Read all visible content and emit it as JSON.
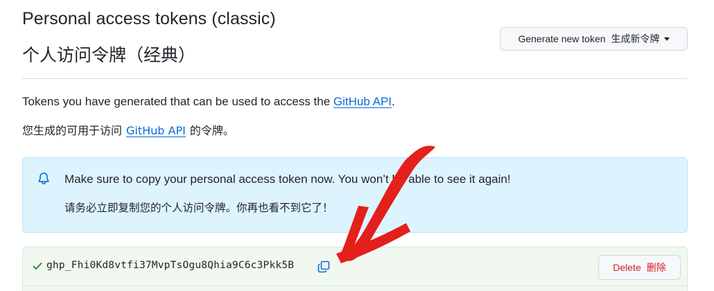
{
  "header": {
    "title_en": "Personal access tokens (classic)",
    "title_zh": "个人访问令牌（经典）",
    "generate_button_en": "Generate new token",
    "generate_button_zh": "生成新令牌"
  },
  "description": {
    "en_prefix": "Tokens you have generated that can be used to access the ",
    "en_link": "GitHub API",
    "en_suffix": ".",
    "zh_prefix": "您生成的可用于访问",
    "zh_link": "GitHub API",
    "zh_suffix": "的令牌。"
  },
  "flash": {
    "icon": "bell-icon",
    "message_en": "Make sure to copy your personal access token now. You won’t be able to see it again!",
    "message_zh": "请务必立即复制您的个人访问令牌。你再也看不到它了！"
  },
  "token": {
    "value": "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",
    "delete_en": "Delete",
    "delete_zh": "删除"
  },
  "colors": {
    "link": "#0969da",
    "flash_bg": "#ddf4ff",
    "token_bg": "#f0f8f0",
    "success": "#1a7f37",
    "danger": "#cf222e",
    "annotation_arrow": "#e3201b"
  }
}
